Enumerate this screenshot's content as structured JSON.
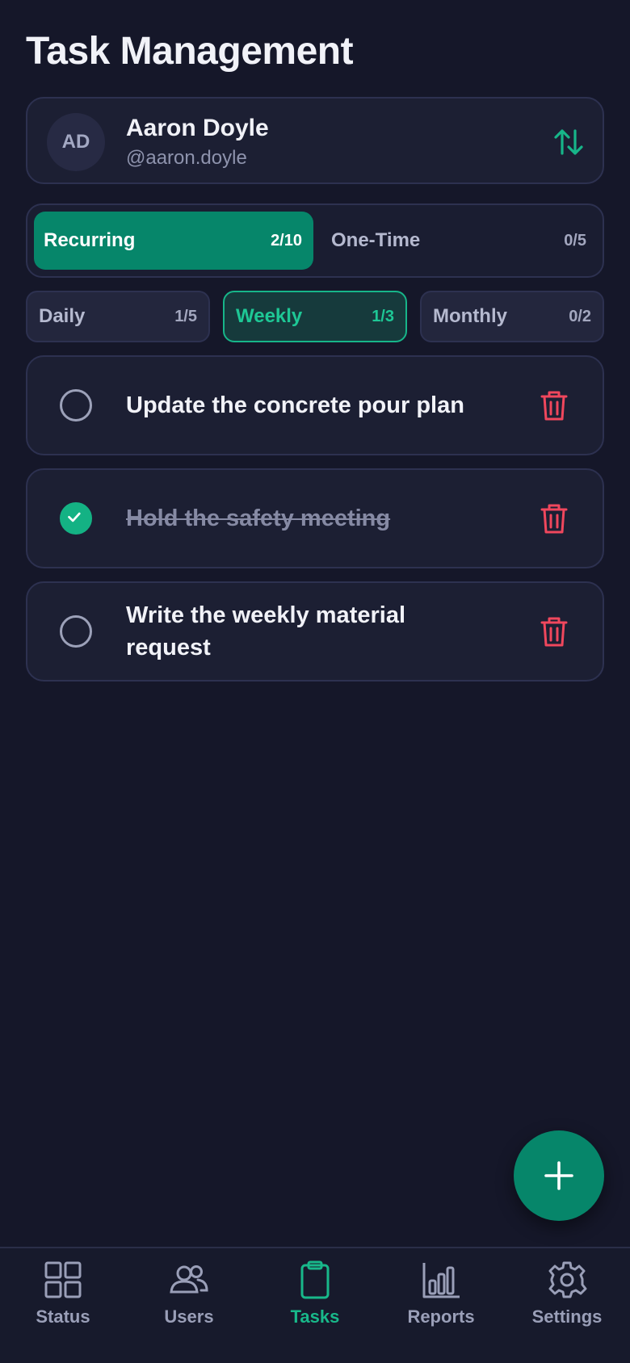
{
  "header": {
    "title": "Task Management"
  },
  "user": {
    "initials": "AD",
    "name": "Aaron Doyle",
    "handle": "@aaron.doyle"
  },
  "type_tabs": [
    {
      "label": "Recurring",
      "count": "2/10",
      "active": true
    },
    {
      "label": "One-Time",
      "count": "0/5",
      "active": false
    }
  ],
  "frequency_tabs": [
    {
      "label": "Daily",
      "count": "1/5",
      "active": false
    },
    {
      "label": "Weekly",
      "count": "1/3",
      "active": true
    },
    {
      "label": "Monthly",
      "count": "0/2",
      "active": false
    }
  ],
  "tasks": [
    {
      "text": "Update the concrete pour plan",
      "completed": false
    },
    {
      "text": "Hold the safety meeting",
      "completed": true
    },
    {
      "text": "Write the weekly material request",
      "completed": false
    }
  ],
  "fab": {
    "icon": "plus-icon"
  },
  "nav": [
    {
      "label": "Status",
      "icon": "grid-icon",
      "active": false
    },
    {
      "label": "Users",
      "icon": "users-icon",
      "active": false
    },
    {
      "label": "Tasks",
      "icon": "clipboard-icon",
      "active": true
    },
    {
      "label": "Reports",
      "icon": "bar-chart-icon",
      "active": false
    },
    {
      "label": "Settings",
      "icon": "gear-icon",
      "active": false
    }
  ],
  "colors": {
    "background": "#151729",
    "card": "#1c1f33",
    "accent": "#06866a",
    "accent_text": "#1ec795",
    "danger": "#f0475d",
    "muted": "#9a9fb8"
  }
}
